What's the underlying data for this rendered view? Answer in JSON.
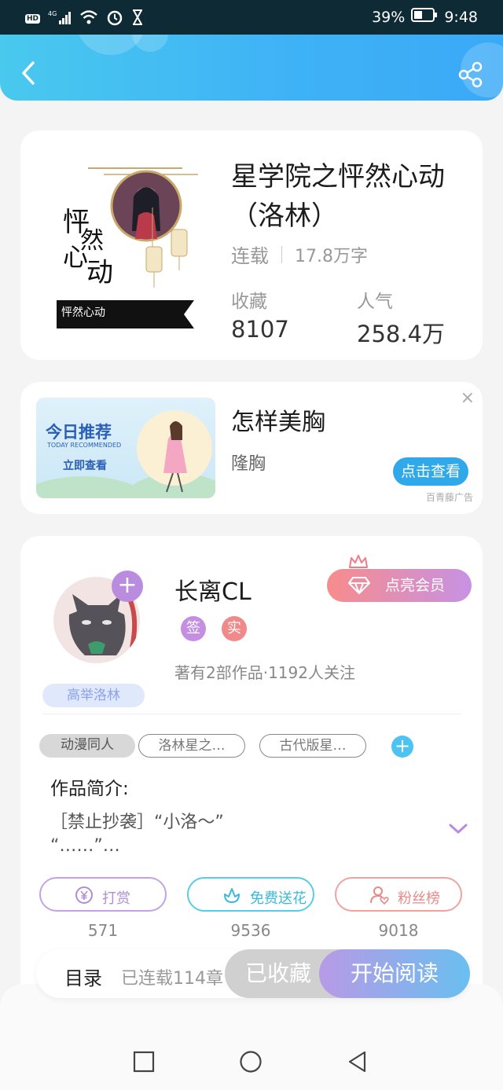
{
  "status_bar": {
    "hd": "HD",
    "network": "4G",
    "battery": "39%",
    "time": "9:48"
  },
  "header": {
    "back_icon": "chevron-left-icon",
    "share_icon": "share-icon"
  },
  "book": {
    "title": "星学院之怦然心动（洛林）",
    "status": "连载",
    "word_count": "17.8万字",
    "favorites_label": "收藏",
    "favorites_value": "8107",
    "popularity_label": "人气",
    "popularity_value": "258.4万",
    "cover_title": "怦然心动"
  },
  "ad": {
    "image_title": "今日推荐",
    "image_subtitle": "TODAY RECOMMENDED",
    "image_cta": "立即查看",
    "title": "怎样美胸",
    "desc": "隆胸",
    "button": "点击查看",
    "source": "百青藤广告",
    "close": "×"
  },
  "author": {
    "name": "长离CL",
    "badge_sign": "签",
    "badge_real": "实",
    "stats": "著有2部作品·1192人关注",
    "fan_badge": "高举洛林",
    "vip_button": "点亮会员"
  },
  "tags": {
    "genre": "动漫同人",
    "tag1": "洛林星之…",
    "tag2": "古代版星…",
    "add": "+"
  },
  "intro": {
    "title": "作品简介:",
    "text_line1": "［禁止抄袭］“小洛～”",
    "text_line2": "“……”…"
  },
  "actions": {
    "reward_label": "打赏",
    "reward_count": "571",
    "flower_label": "免费送花",
    "flower_count": "9536",
    "fans_label": "粉丝榜",
    "fans_count": "9018"
  },
  "toolbar": {
    "toc_label": "目录",
    "toc_count": "已连载114章",
    "collected_button": "已收藏",
    "read_button": "开始阅读"
  },
  "colors": {
    "header_gradient_start": "#49c9ee",
    "header_gradient_end": "#3aa9f7",
    "accent_purple": "#b98cdf",
    "accent_blue": "#2fa9ea"
  }
}
